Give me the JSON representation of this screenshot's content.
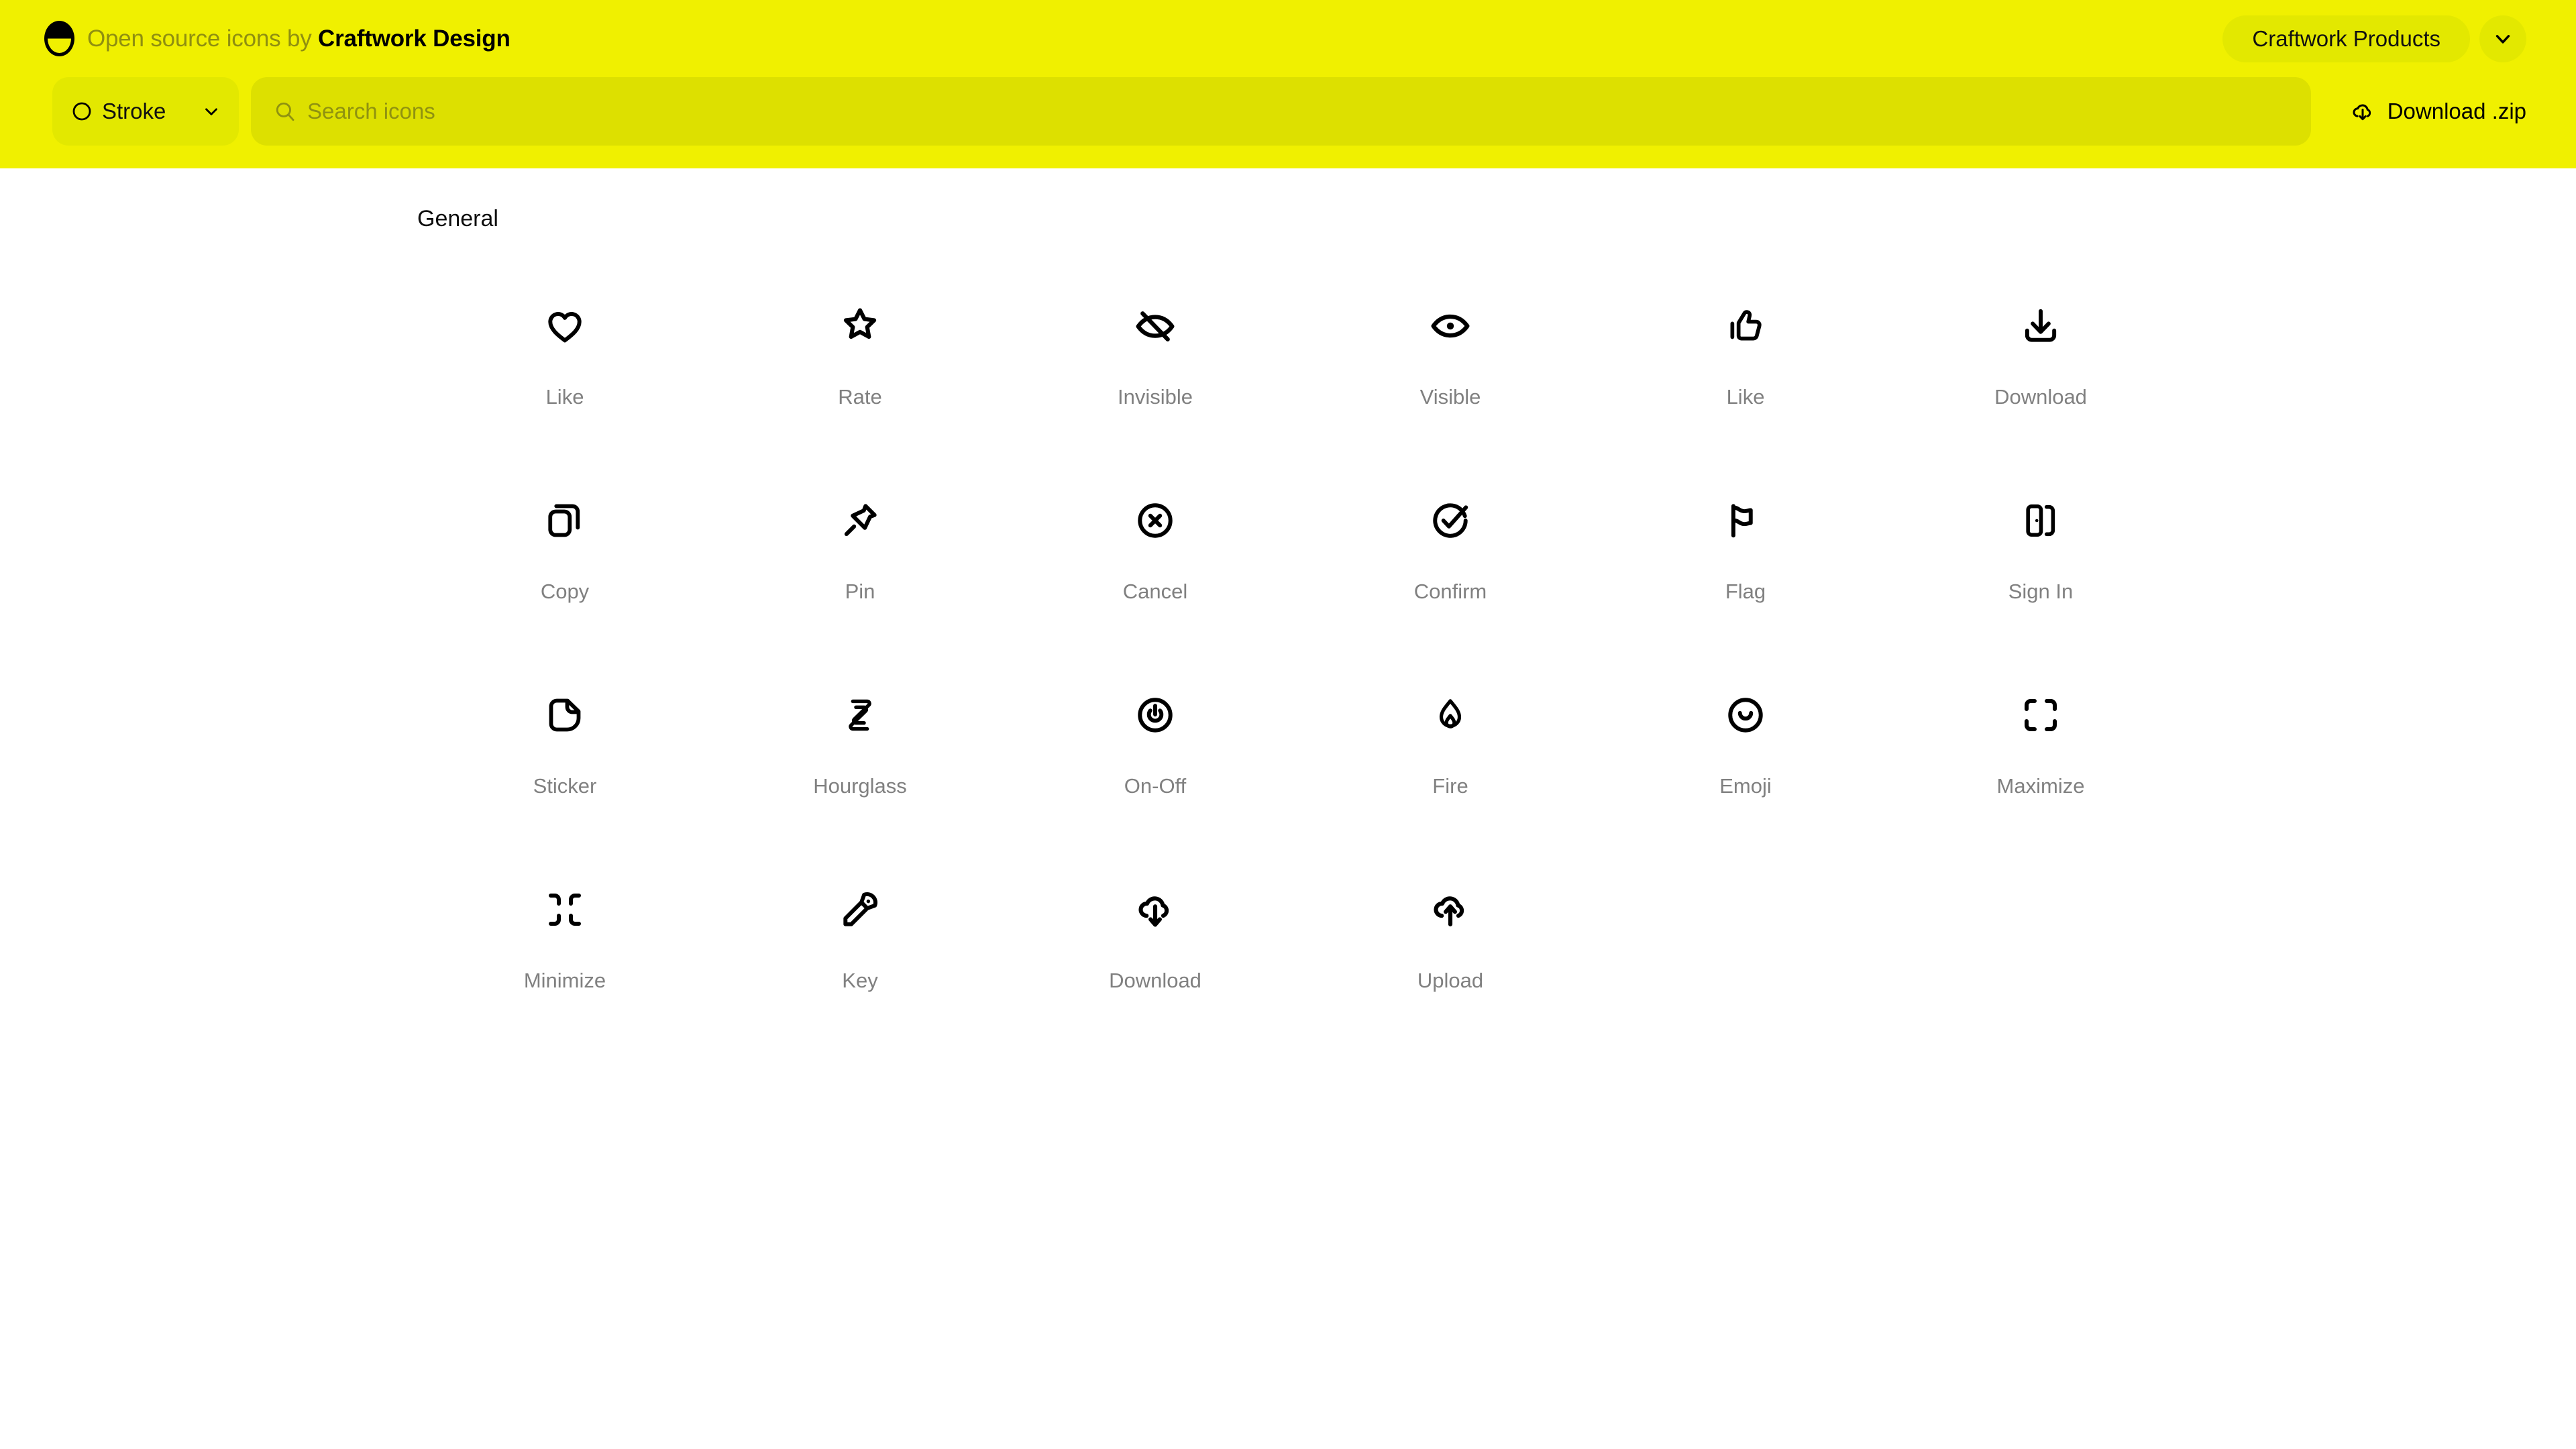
{
  "header": {
    "logo_icon": "craftwork-logo-icon",
    "brand_prefix": "Open source icons by ",
    "brand_name": "Craftwork Design",
    "products_label": "Craftwork Products",
    "products_caret_icon": "chevron-down-icon",
    "colors": {
      "header_background": "#f0f000",
      "control_fill": "#e3e800",
      "search_fill": "#dde000",
      "placeholder_text": "#8f9210",
      "label_text": "#808080"
    }
  },
  "toolbar": {
    "style_select": {
      "icon": "circle-outline-icon",
      "value": "Stroke",
      "caret_icon": "chevron-down-icon"
    },
    "search": {
      "icon": "search-icon",
      "value": "",
      "placeholder": "Search icons"
    },
    "download": {
      "icon": "cloud-download-icon",
      "label": "Download .zip"
    }
  },
  "main": {
    "section_title": "General",
    "icons": [
      {
        "label": "Like",
        "icon": "heart-icon"
      },
      {
        "label": "Rate",
        "icon": "star-icon"
      },
      {
        "label": "Invisible",
        "icon": "eye-off-icon"
      },
      {
        "label": "Visible",
        "icon": "eye-icon"
      },
      {
        "label": "Like",
        "icon": "thumbs-up-icon"
      },
      {
        "label": "Download",
        "icon": "download-tray-icon"
      },
      {
        "label": "Copy",
        "icon": "copy-icon"
      },
      {
        "label": "Pin",
        "icon": "pin-icon"
      },
      {
        "label": "Cancel",
        "icon": "circle-x-icon"
      },
      {
        "label": "Confirm",
        "icon": "circle-check-icon"
      },
      {
        "label": "Flag",
        "icon": "flag-icon"
      },
      {
        "label": "Sign In",
        "icon": "sign-in-door-icon"
      },
      {
        "label": "Sticker",
        "icon": "sticker-page-icon"
      },
      {
        "label": "Hourglass",
        "icon": "hourglass-icon"
      },
      {
        "label": "On-Off",
        "icon": "power-icon"
      },
      {
        "label": "Fire",
        "icon": "fire-icon"
      },
      {
        "label": "Emoji",
        "icon": "emoji-smile-icon"
      },
      {
        "label": "Maximize",
        "icon": "maximize-icon"
      },
      {
        "label": "Minimize",
        "icon": "minimize-icon"
      },
      {
        "label": "Key",
        "icon": "key-icon"
      },
      {
        "label": "Download",
        "icon": "cloud-download-icon"
      },
      {
        "label": "Upload",
        "icon": "cloud-upload-icon"
      }
    ]
  }
}
